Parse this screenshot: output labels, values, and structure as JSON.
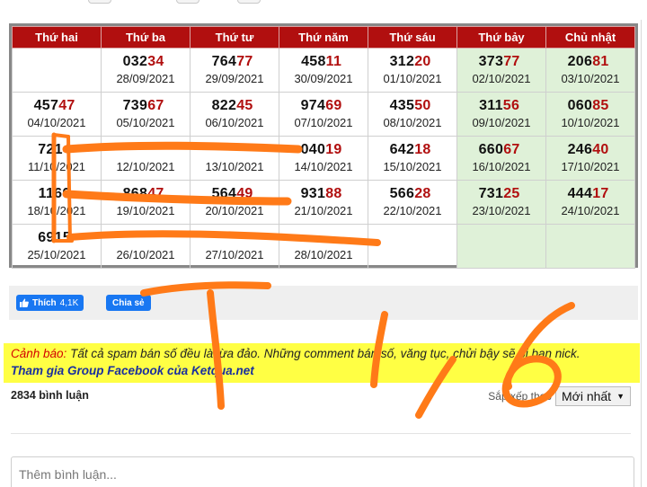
{
  "header": [
    "Thứ hai",
    "Thứ ba",
    "Thứ tư",
    "Thứ năm",
    "Thứ sáu",
    "Thứ bảy",
    "Chủ nhật"
  ],
  "rows": [
    [
      {
        "head": "",
        "tail": "",
        "date": "",
        "weekend": false
      },
      {
        "head": "032",
        "tail": "34",
        "date": "28/09/2021",
        "weekend": false
      },
      {
        "head": "764",
        "tail": "77",
        "date": "29/09/2021",
        "weekend": false
      },
      {
        "head": "458",
        "tail": "11",
        "date": "30/09/2021",
        "weekend": false
      },
      {
        "head": "312",
        "tail": "20",
        "date": "01/10/2021",
        "weekend": false
      },
      {
        "head": "373",
        "tail": "77",
        "date": "02/10/2021",
        "weekend": true
      },
      {
        "head": "206",
        "tail": "81",
        "date": "03/10/2021",
        "weekend": true
      }
    ],
    [
      {
        "head": "457",
        "tail": "47",
        "date": "04/10/2021",
        "weekend": false
      },
      {
        "head": "739",
        "tail": "67",
        "date": "05/10/2021",
        "weekend": false
      },
      {
        "head": "822",
        "tail": "45",
        "date": "06/10/2021",
        "weekend": false
      },
      {
        "head": "974",
        "tail": "69",
        "date": "07/10/2021",
        "weekend": false
      },
      {
        "head": "435",
        "tail": "50",
        "date": "08/10/2021",
        "weekend": false
      },
      {
        "head": "311",
        "tail": "56",
        "date": "09/10/2021",
        "weekend": true
      },
      {
        "head": "060",
        "tail": "85",
        "date": "10/10/2021",
        "weekend": true
      }
    ],
    [
      {
        "head": "721",
        "tail": "4",
        "date": "11/10/2021",
        "weekend": false
      },
      {
        "head": "",
        "tail": "",
        "date": "12/10/2021",
        "weekend": false
      },
      {
        "head": "",
        "tail": "",
        "date": "13/10/2021",
        "weekend": false
      },
      {
        "head": "040",
        "tail": "19",
        "date": "14/10/2021",
        "weekend": false
      },
      {
        "head": "642",
        "tail": "18",
        "date": "15/10/2021",
        "weekend": false
      },
      {
        "head": "660",
        "tail": "67",
        "date": "16/10/2021",
        "weekend": true
      },
      {
        "head": "246",
        "tail": "40",
        "date": "17/10/2021",
        "weekend": true
      }
    ],
    [
      {
        "head": "1160",
        "tail": "",
        "date": "18/10/2021",
        "weekend": false
      },
      {
        "head": "868",
        "tail": "47",
        "date": "19/10/2021",
        "weekend": false
      },
      {
        "head": "564",
        "tail": "49",
        "date": "20/10/2021",
        "weekend": false
      },
      {
        "head": "931",
        "tail": "88",
        "date": "21/10/2021",
        "weekend": false
      },
      {
        "head": "566",
        "tail": "28",
        "date": "22/10/2021",
        "weekend": false
      },
      {
        "head": "731",
        "tail": "25",
        "date": "23/10/2021",
        "weekend": true
      },
      {
        "head": "444",
        "tail": "17",
        "date": "24/10/2021",
        "weekend": true
      }
    ],
    [
      {
        "head": "6915",
        "tail": "",
        "date": "25/10/2021",
        "weekend": false
      },
      {
        "head": "",
        "tail": "",
        "date": "26/10/2021",
        "weekend": false
      },
      {
        "head": "",
        "tail": "",
        "date": "27/10/2021",
        "weekend": false
      },
      {
        "head": "",
        "tail": "",
        "date": "28/10/2021",
        "weekend": false
      },
      {
        "head": "",
        "tail": "",
        "date": "",
        "weekend": false
      },
      {
        "head": "",
        "tail": "",
        "date": "",
        "weekend": true
      },
      {
        "head": "",
        "tail": "",
        "date": "",
        "weekend": true
      }
    ]
  ],
  "share": {
    "like_label": "Thích",
    "like_count": "4,1K",
    "share_label": "Chia sẻ"
  },
  "warning": {
    "label": "Cảnh báo:",
    "text": "Tất cả spam bán số đều là lừa đảo. Những comment bán số, văng tục, chửi bậy sẽ bị ban nick.",
    "group_link": "Tham gia Group Facebook của Ketqua.net"
  },
  "comments": {
    "count_label": "2834 bình luận",
    "sort_label": "Sắp xếp theo",
    "sort_value": "Mới nhất",
    "placeholder": "Thêm bình luận..."
  },
  "colors": {
    "header_bg": "#b10f0f",
    "weekend_bg": "#dff1d8",
    "warning_bg": "#ffff44",
    "scribble": "#ff7a18",
    "facebook": "#1877f2"
  }
}
